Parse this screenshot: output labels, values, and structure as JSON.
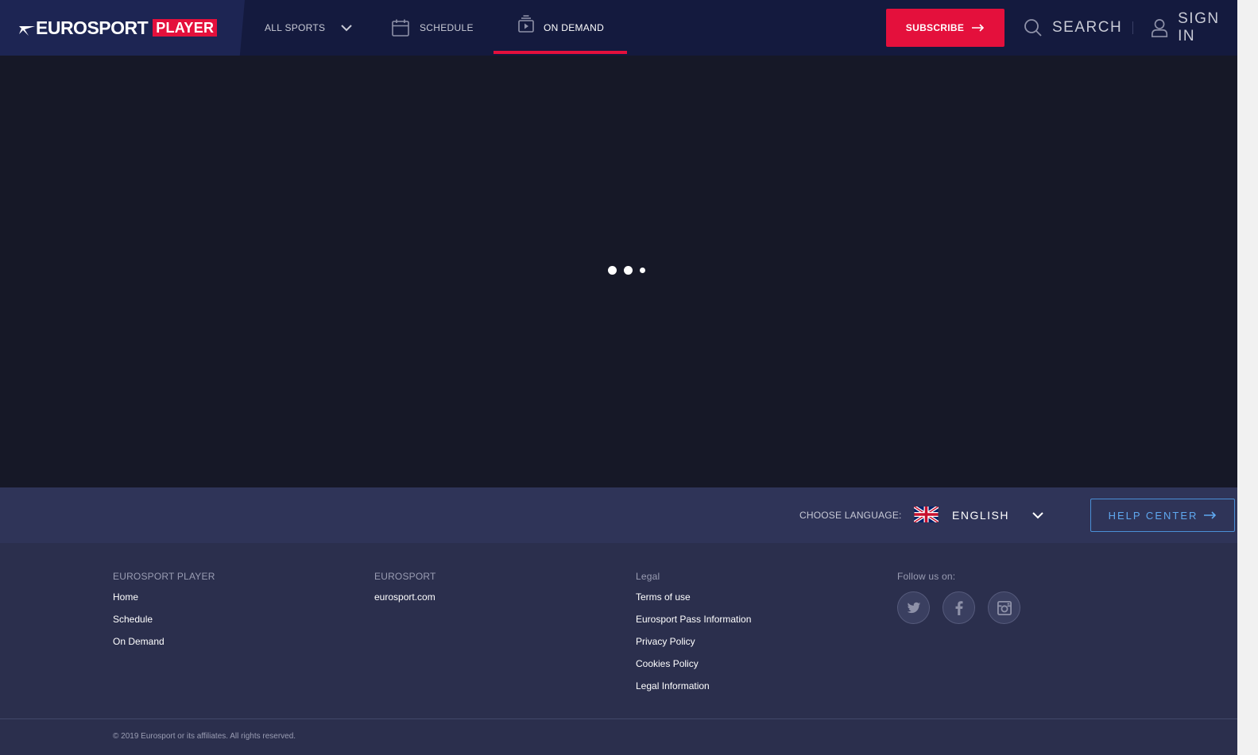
{
  "header": {
    "logo_word": "EUROSPORT",
    "logo_badge": "PLAYER",
    "nav": {
      "all_sports": "ALL SPORTS",
      "schedule": "SCHEDULE",
      "on_demand": "ON DEMAND"
    },
    "active_tab": "on_demand",
    "subscribe": "SUBSCRIBE",
    "search": "SEARCH",
    "sign_in": "SIGN IN"
  },
  "main": {
    "state": "loading"
  },
  "language_bar": {
    "label": "CHOOSE LANGUAGE:",
    "selected": "ENGLISH",
    "flag_icon": "uk-flag-icon",
    "help_center": "HELP CENTER"
  },
  "footer": {
    "col1": {
      "heading": "EUROSPORT PLAYER",
      "links": [
        "Home",
        "Schedule",
        "On Demand"
      ]
    },
    "col2": {
      "heading": "EUROSPORT",
      "links": [
        "eurosport.com"
      ]
    },
    "col3": {
      "heading": "Legal",
      "links": [
        "Terms of use",
        "Eurosport Pass Information",
        "Privacy Policy",
        "Cookies Policy",
        "Legal Information"
      ]
    },
    "col4": {
      "heading": "Follow us on:",
      "social": [
        "twitter-icon",
        "facebook-icon",
        "instagram-icon"
      ]
    },
    "copyright": "© 2019 Eurosport or its affiliates. All rights reserved."
  },
  "colors": {
    "accent": "#e4103c",
    "header_bg": "#141a3e",
    "main_bg": "#161827",
    "footer_bg": "#2b2f4d",
    "help_link": "#5fa8f0"
  }
}
